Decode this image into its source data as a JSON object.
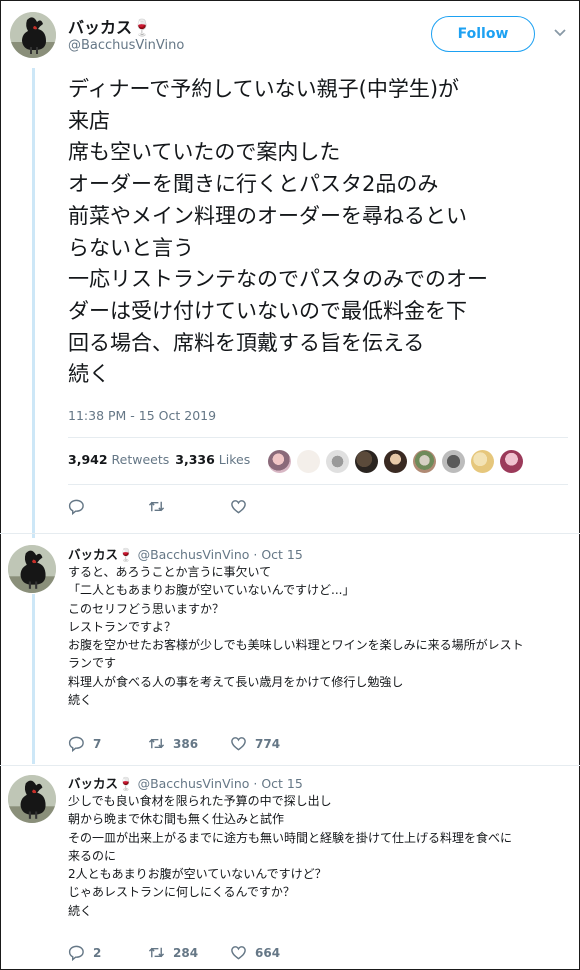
{
  "main_tweet": {
    "name": "バッカス🍷",
    "handle": "@BacchusVinVino",
    "follow_label": "Follow",
    "lines": [
      "ディナーで予約していない親子(中学生)が",
      "来店",
      "席も空いていたので案内した",
      "オーダーを聞きに行くとパスタ2品のみ",
      "前菜やメイン料理のオーダーを尋ねるとい",
      "らないと言う",
      "一応リストランテなのでパスタのみでのオー",
      "ダーは受け付けていないので最低料金を下",
      "回る場合、席料を頂戴する旨を伝える",
      "続く"
    ],
    "timestamp": "11:38 PM - 15 Oct 2019",
    "retweets_count": "3,942",
    "retweets_label": "Retweets",
    "likes_count": "3,336",
    "likes_label": "Likes"
  },
  "replies": [
    {
      "name": "バッカス🍷",
      "handle": "@BacchusVinVino",
      "date": "· Oct 15",
      "lines": [
        "すると、あろうことか言うに事欠いて",
        "「二人ともあまりお腹が空いていないんですけど...」",
        "このセリフどう思いますか？",
        "レストランですよ？",
        "お腹を空かせたお客様が少しでも美味しい料理とワインを楽しみに来る場所がレスト",
        "ランです",
        "料理人が食べる人の事を考えて長い歳月をかけて修行し勉強し",
        "続く"
      ],
      "replies_count": "7",
      "retweets_count": "386",
      "likes_count": "774"
    },
    {
      "name": "バッカス🍷",
      "handle": "@BacchusVinVino",
      "date": "· Oct 15",
      "lines": [
        "少しでも良い食材を限られた予算の中で探し出し",
        "朝から晩まで休む間も無く仕込みと試作",
        "その一皿が出来上がるまでに途方も無い時間と経験を掛けて仕上げる料理を食べに",
        "来るのに",
        "2人ともあまりお腹が空いていないんですけど？",
        "じゃあレストランに何しにくるんですか？",
        "続く"
      ],
      "replies_count": "2",
      "retweets_count": "284",
      "likes_count": "664"
    }
  ],
  "colors": {
    "accent": "#1da1f2",
    "secondary_text": "#657786",
    "thread_line": "#cde7f7"
  }
}
